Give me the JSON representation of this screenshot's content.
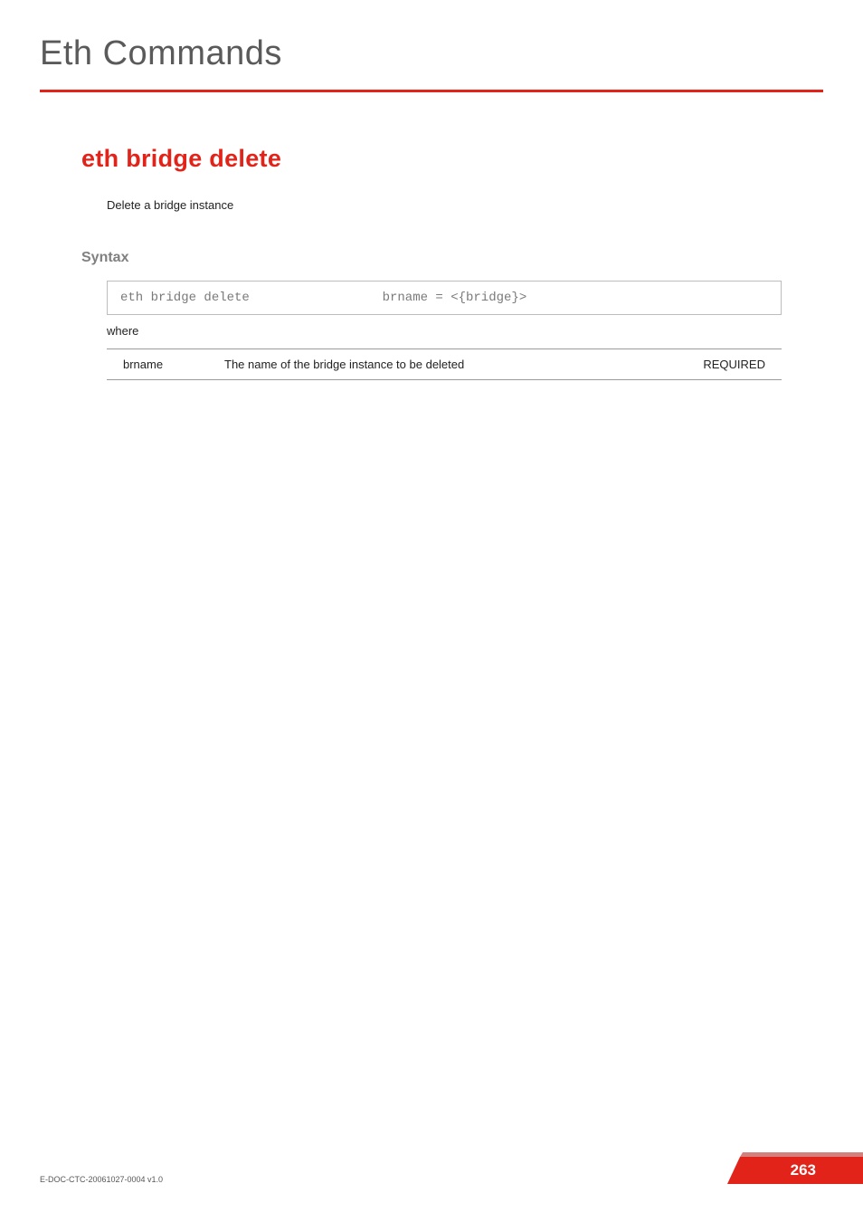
{
  "header": {
    "page_title": "Eth Commands"
  },
  "section": {
    "heading": "eth bridge delete",
    "description": "Delete a bridge instance"
  },
  "syntax": {
    "label": "Syntax",
    "command": "eth bridge delete",
    "args": "brname = <{bridge}>",
    "where_label": "where",
    "params": [
      {
        "name": "brname",
        "description": "The name of the  bridge instance to be deleted",
        "required": "REQUIRED"
      }
    ]
  },
  "footer": {
    "doc_ref": "E-DOC-CTC-20061027-0004 v1.0",
    "page_number": "263"
  },
  "colors": {
    "accent": "#e2231a",
    "muted_text": "#808080",
    "body_text": "#222222"
  }
}
